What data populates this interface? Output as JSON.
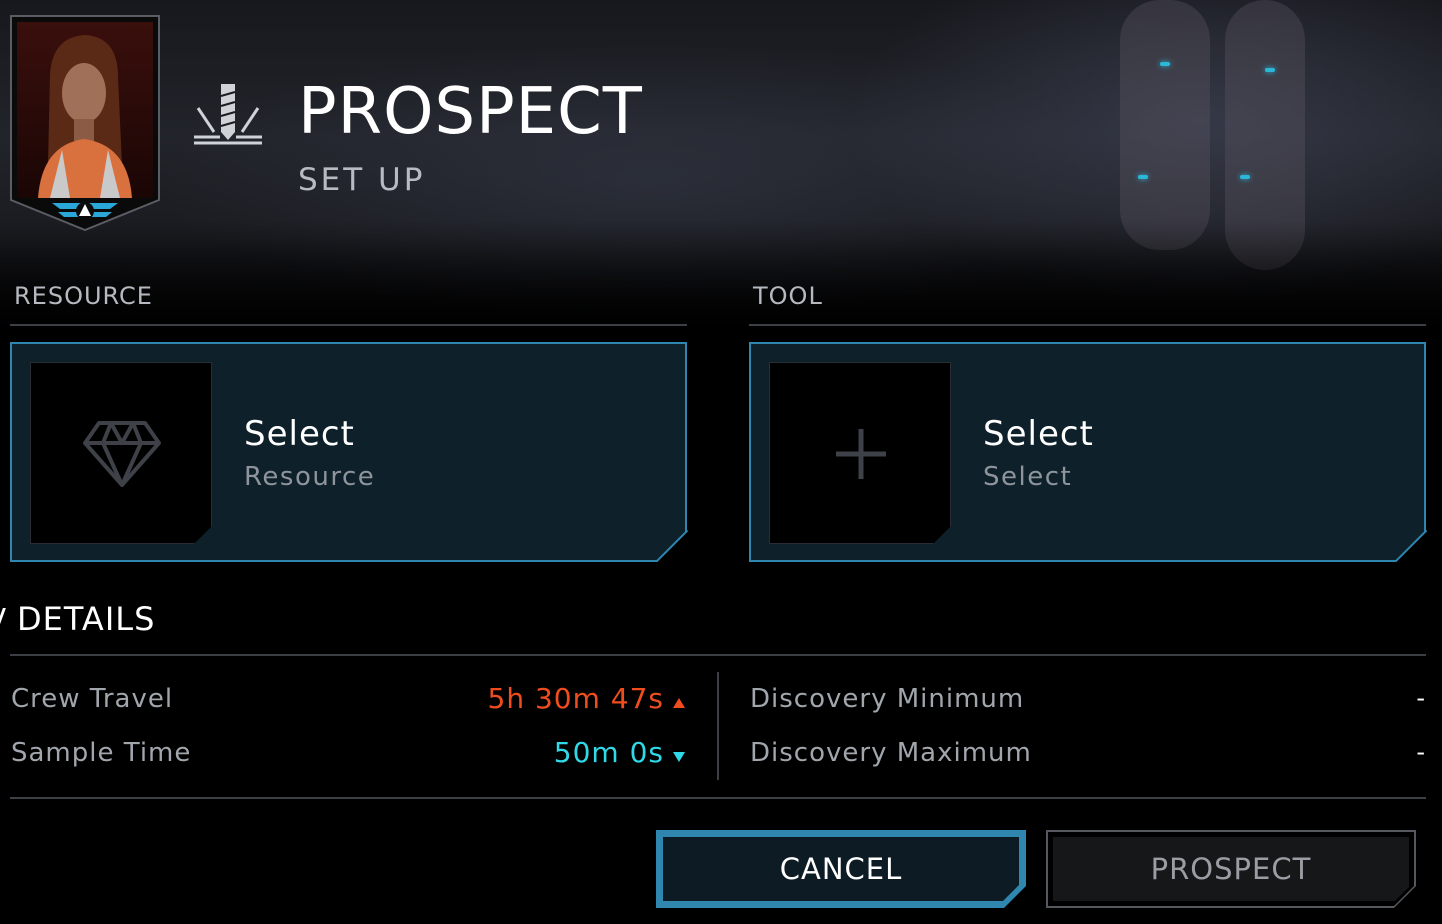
{
  "header": {
    "title": "PROSPECT",
    "subtitle": "SET UP",
    "icon": "drill-icon",
    "avatar": "crew-portrait"
  },
  "resource": {
    "section_label": "RESOURCE",
    "card_title": "Select",
    "card_subtitle": "Resource",
    "icon": "diamond-icon"
  },
  "tool": {
    "section_label": "TOOL",
    "card_title": "Select",
    "card_subtitle": "Select",
    "icon": "plus-icon"
  },
  "details": {
    "title": "DETAILS",
    "rows_left": [
      {
        "label": "Crew Travel",
        "value": "5h 30m 47s",
        "trend": "up",
        "color": "#ef4d1e"
      },
      {
        "label": "Sample Time",
        "value": "50m 0s",
        "trend": "down",
        "color": "#2fd9e8"
      }
    ],
    "rows_right": [
      {
        "label": "Discovery Minimum",
        "value": "-"
      },
      {
        "label": "Discovery Maximum",
        "value": "-"
      }
    ]
  },
  "buttons": {
    "cancel": "CANCEL",
    "prospect": "PROSPECT"
  },
  "colors": {
    "accent": "#2f87b0",
    "card_bg": "#0e2029",
    "warning": "#ef4d1e",
    "positive": "#2fd9e8"
  }
}
